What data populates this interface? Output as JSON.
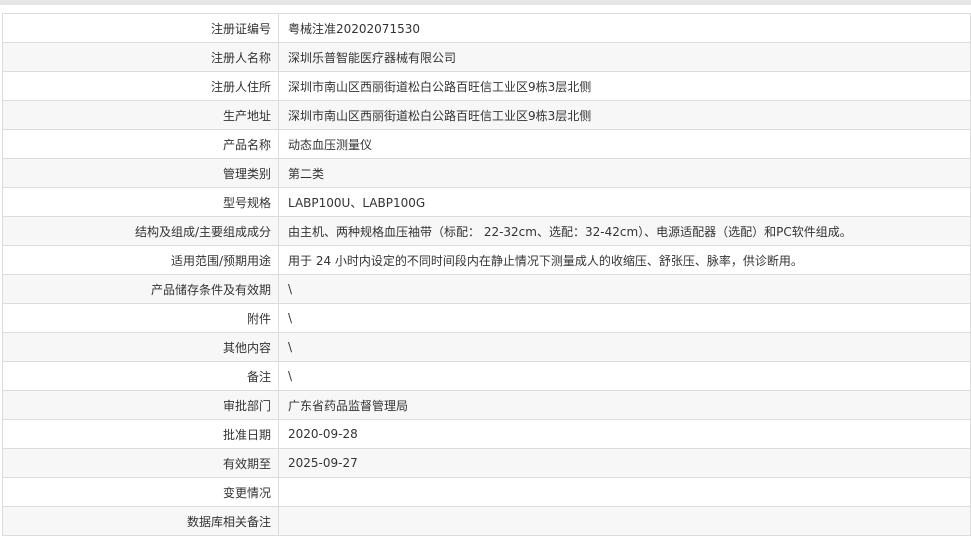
{
  "rows": [
    {
      "label": "注册证编号",
      "value": "粤械注准20202071530"
    },
    {
      "label": "注册人名称",
      "value": "深圳乐普智能医疗器械有限公司"
    },
    {
      "label": "注册人住所",
      "value": "深圳市南山区西丽街道松白公路百旺信工业区9栋3层北侧"
    },
    {
      "label": "生产地址",
      "value": "深圳市南山区西丽街道松白公路百旺信工业区9栋3层北侧"
    },
    {
      "label": "产品名称",
      "value": "动态血压测量仪"
    },
    {
      "label": "管理类别",
      "value": "第二类"
    },
    {
      "label": "型号规格",
      "value": "LABP100U、LABP100G"
    },
    {
      "label": "结构及组成/主要组成成分",
      "value": "由主机、两种规格血压袖带（标配： 22-32cm、选配：32-42cm）、电源适配器（选配）和PC软件组成。"
    },
    {
      "label": "适用范围/预期用途",
      "value": "用于 24 小时内设定的不同时间段内在静止情况下测量成人的收缩压、舒张压、脉率，供诊断用。"
    },
    {
      "label": "产品储存条件及有效期",
      "value": "\\"
    },
    {
      "label": "附件",
      "value": "\\"
    },
    {
      "label": "其他内容",
      "value": "\\"
    },
    {
      "label": "备注",
      "value": "\\"
    },
    {
      "label": "审批部门",
      "value": "广东省药品监督管理局"
    },
    {
      "label": "批准日期",
      "value": "2020-09-28"
    },
    {
      "label": "有效期至",
      "value": "2025-09-27"
    },
    {
      "label": "变更情况",
      "value": ""
    },
    {
      "label": "数据库相关备注",
      "value": ""
    }
  ]
}
